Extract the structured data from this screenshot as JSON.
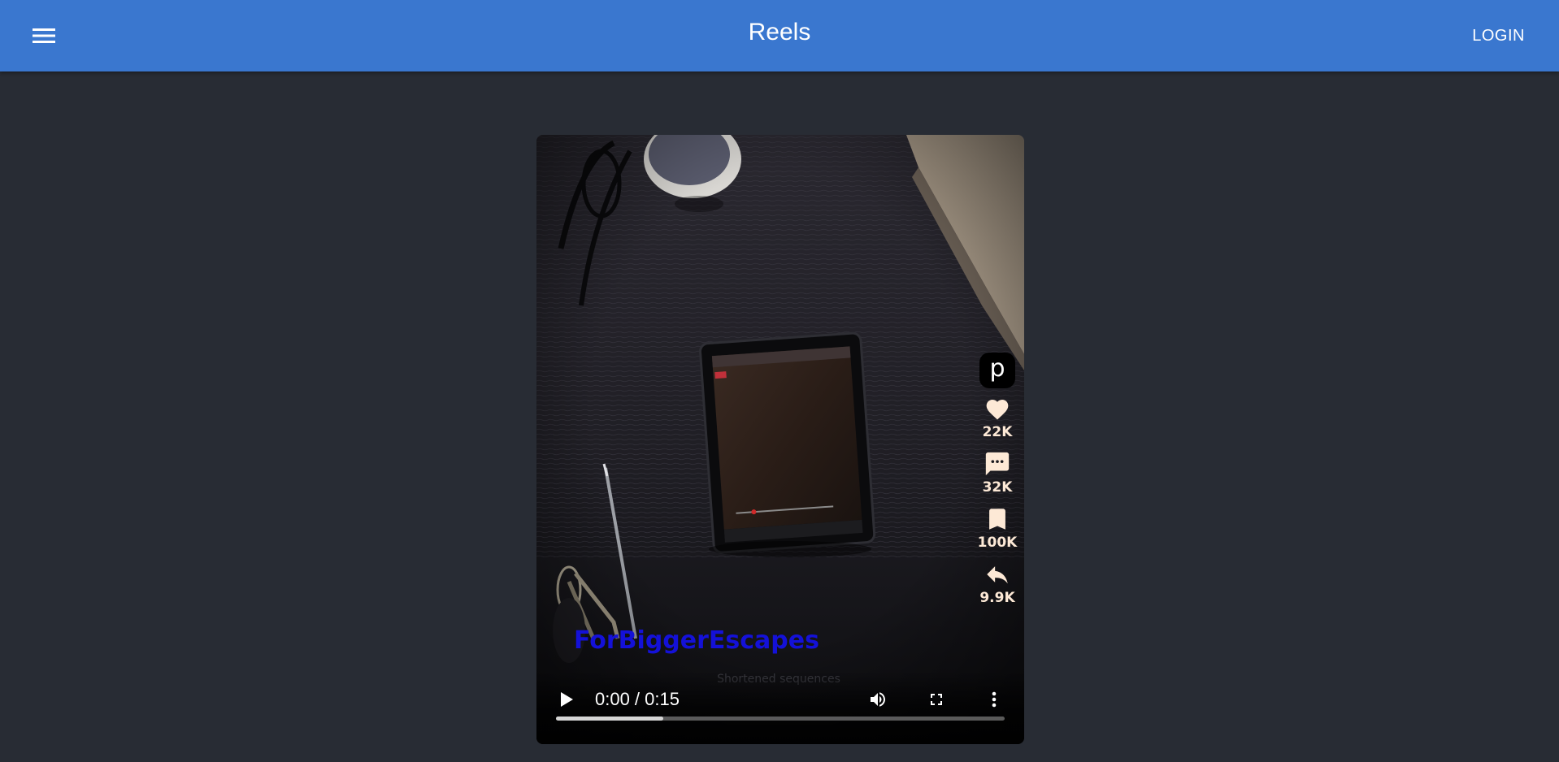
{
  "header": {
    "title": "Reels",
    "login_label": "LOGIN",
    "menu_icon": "hamburger-menu-icon",
    "background_color": "#3a77cf"
  },
  "reel": {
    "avatar_letter": "p",
    "caption": "ForBiggerEscapes",
    "caption_color": "#1411d8",
    "actions": [
      {
        "icon": "heart-icon",
        "count": "22K"
      },
      {
        "icon": "comment-icon",
        "count": "32K"
      },
      {
        "icon": "bookmark-icon",
        "count": "100K"
      },
      {
        "icon": "share-icon",
        "count": "9.9K"
      }
    ],
    "player": {
      "time_display": "0:00 / 0:15",
      "progress_buffered": 0.24,
      "icons": [
        "play-icon",
        "volume-icon",
        "fullscreen-icon",
        "more-options-icon"
      ]
    }
  },
  "colors": {
    "page_background": "#282c34",
    "action_color": "#fde9d6"
  }
}
